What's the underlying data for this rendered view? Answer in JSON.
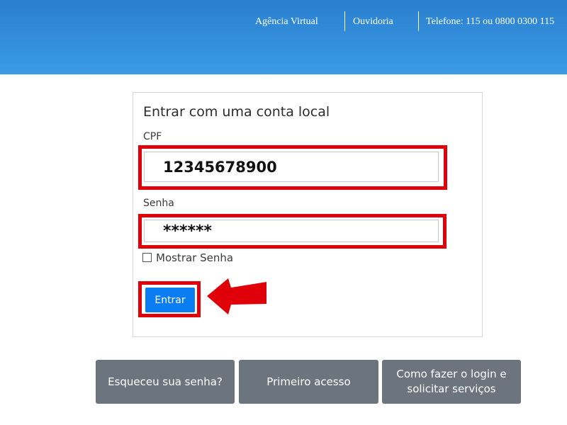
{
  "header": {
    "nav": {
      "agencia": "Agência Virtual",
      "ouvidoria": "Ouvidoria",
      "telefone": "Telefone: 115 ou 0800 0300 115"
    }
  },
  "login": {
    "title": "Entrar com uma conta local",
    "cpf_label": "CPF",
    "cpf_value": "12345678900",
    "senha_label": "Senha",
    "senha_value": "******",
    "show_password_label": "Mostrar Senha",
    "show_password_checked": false,
    "submit_label": "Entrar"
  },
  "actions": {
    "forgot": "Esqueceu sua senha?",
    "first_access": "Primeiro acesso",
    "how_to": "Como fazer o login e solicitar serviços"
  },
  "colors": {
    "header_top": "#2a7fcf",
    "header_bottom": "#3b9be3",
    "highlight": "#e0000a",
    "primary": "#0a7df2",
    "secondary": "#6c757d"
  },
  "icons": {
    "annotation_arrow": "arrow-left-icon"
  }
}
